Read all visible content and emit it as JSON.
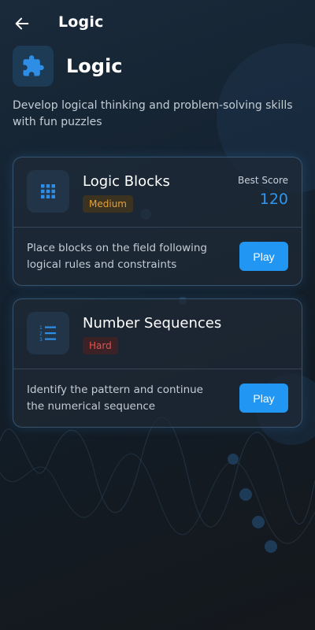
{
  "app_bar": {
    "back_icon": "arrow-left-icon",
    "title": "Logic"
  },
  "hero": {
    "icon": "puzzle-icon",
    "title": "Logic",
    "description": "Develop logical thinking and problem-solving skills with fun puzzles"
  },
  "games": [
    {
      "title": "Logic Blocks",
      "icon": "grid-icon",
      "difficulty": "Medium",
      "best_score_label": "Best Score",
      "best_score": "120",
      "description": "Place blocks on the field following logical rules and constraints",
      "play_label": "Play"
    },
    {
      "title": "Number Sequences",
      "icon": "numbered-list-icon",
      "difficulty": "Hard",
      "description": "Identify the pattern and continue the numerical sequence",
      "play_label": "Play"
    }
  ],
  "colors": {
    "accent": "#2196F3",
    "medium": "#E6A03A",
    "hard": "#E0534F",
    "background": "#141C24"
  }
}
